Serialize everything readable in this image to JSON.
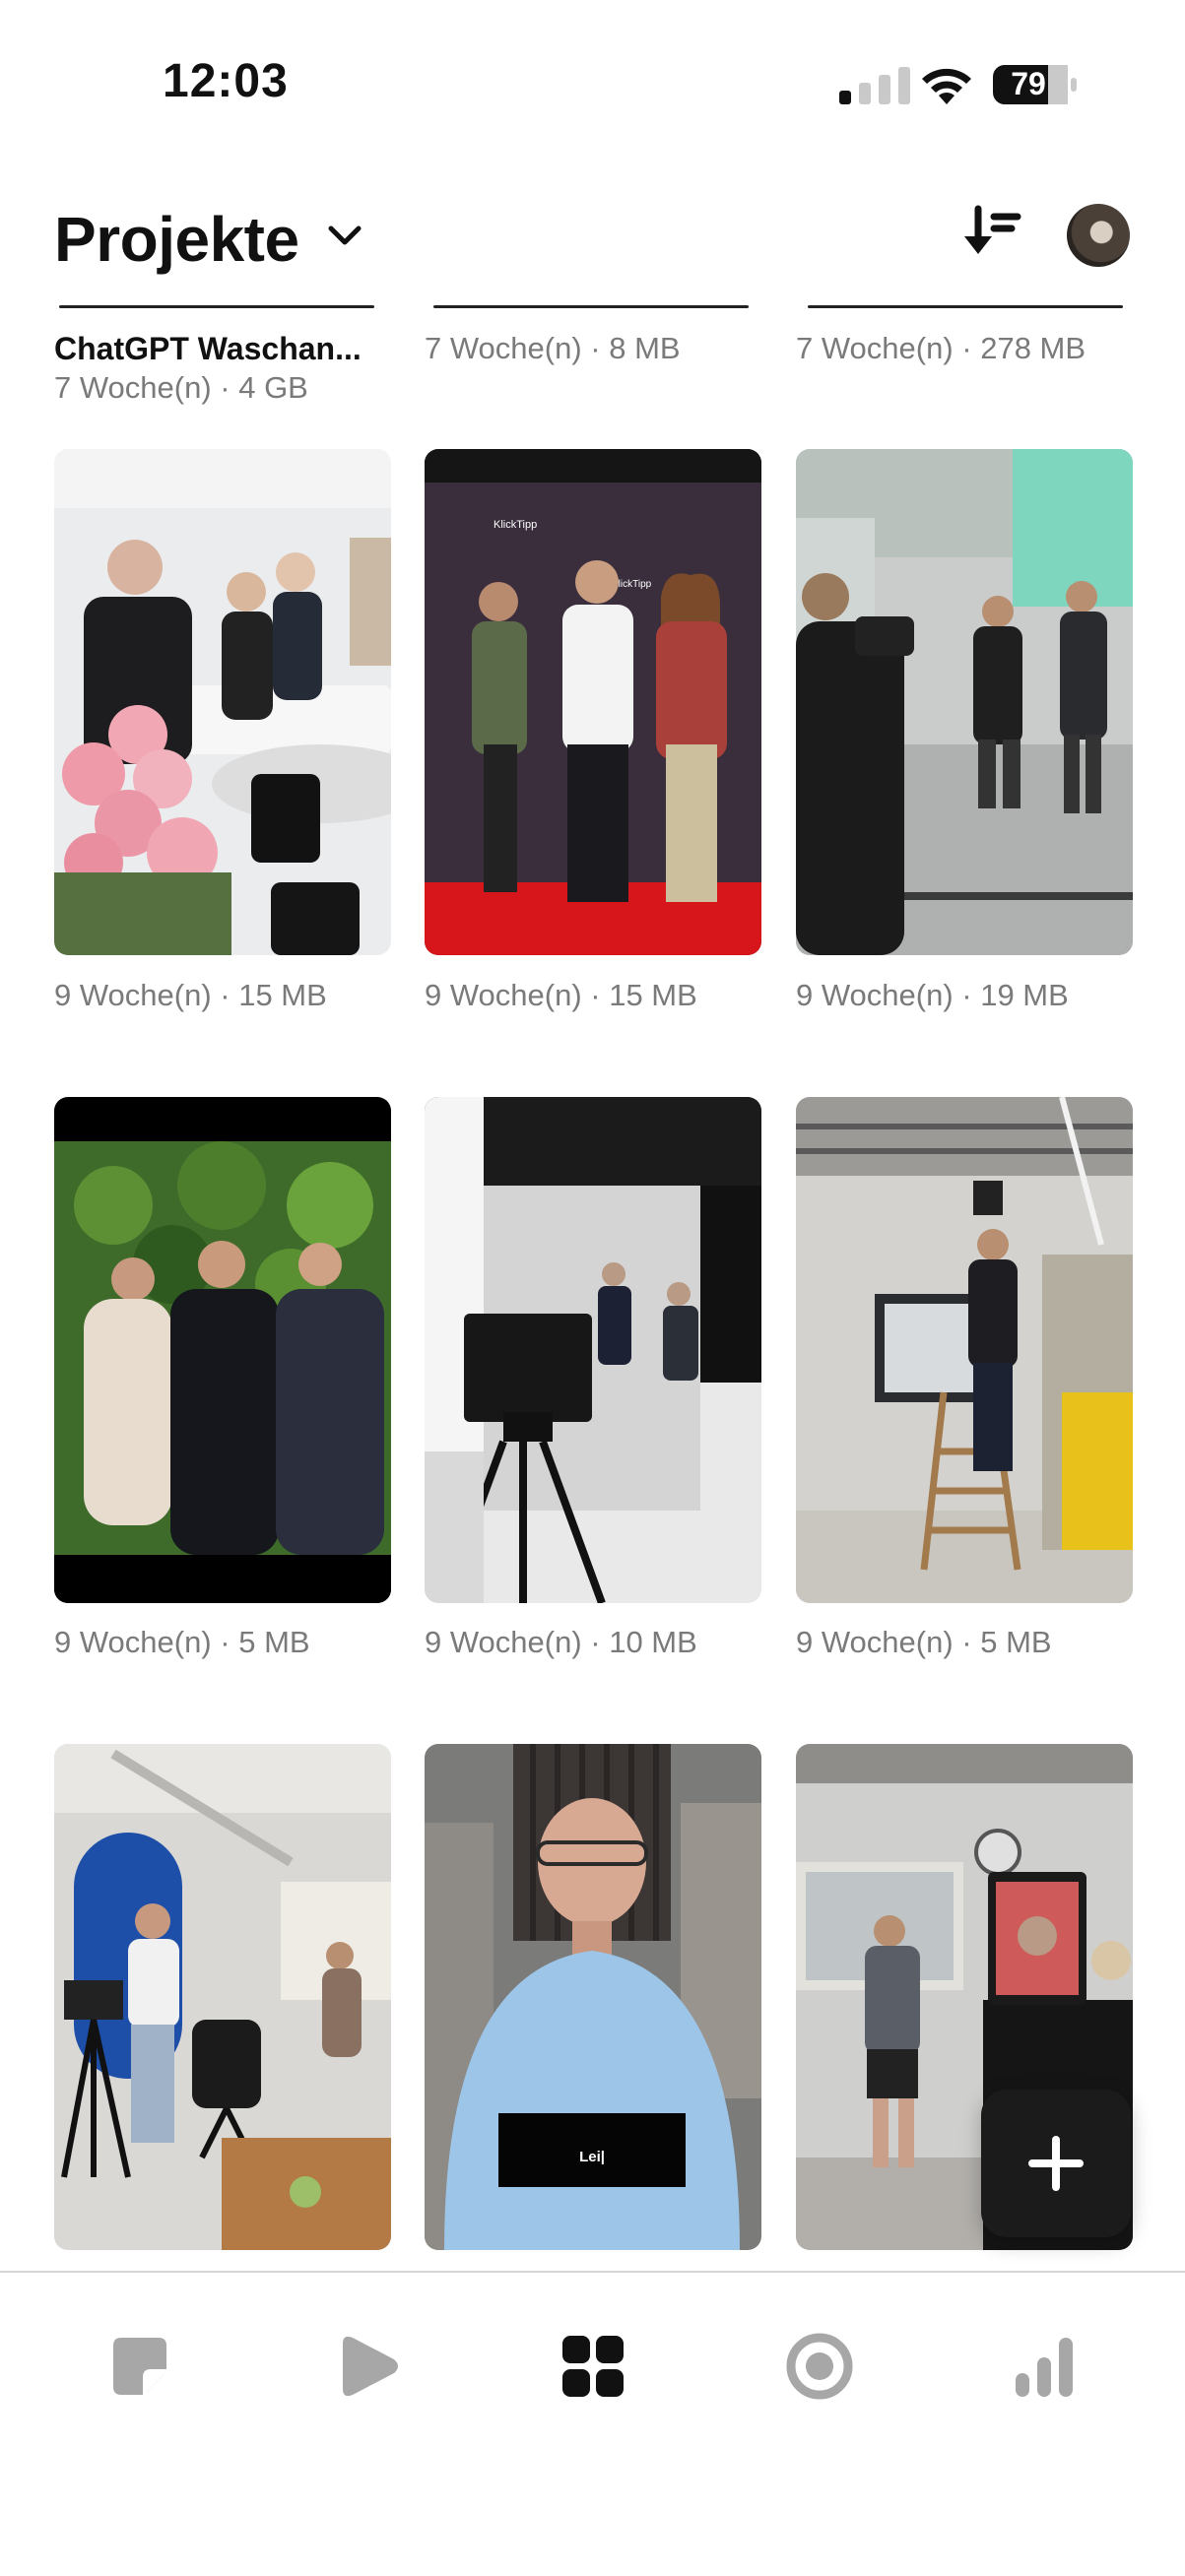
{
  "status_bar": {
    "time": "12:03",
    "battery": "79"
  },
  "header": {
    "title": "Projekte"
  },
  "top_row": [
    {
      "name": "ChatGPT Waschan...",
      "meta": "7 Woche(n) · 4 GB"
    },
    {
      "meta": "7 Woche(n) · 8 MB"
    },
    {
      "meta": "7 Woche(n) · 278 MB"
    }
  ],
  "projects": [
    {
      "meta": "9 Woche(n) · 15 MB"
    },
    {
      "meta": "9 Woche(n) · 15 MB"
    },
    {
      "meta": "9 Woche(n) · 19 MB"
    },
    {
      "meta": "9 Woche(n) · 5 MB"
    },
    {
      "meta": "9 Woche(n) · 10 MB"
    },
    {
      "meta": "9 Woche(n) · 5 MB"
    },
    {
      "meta": ""
    },
    {
      "meta": "",
      "caption": "Lei|"
    },
    {
      "meta": ""
    }
  ],
  "nav": {
    "items": [
      "notes-icon",
      "play-icon",
      "grid-icon",
      "record-icon",
      "stats-icon"
    ],
    "active": "grid-icon"
  },
  "colors": {
    "accent": "#111111",
    "meta_text": "#7a7a7a",
    "nav_inactive": "#a7a7a7"
  }
}
